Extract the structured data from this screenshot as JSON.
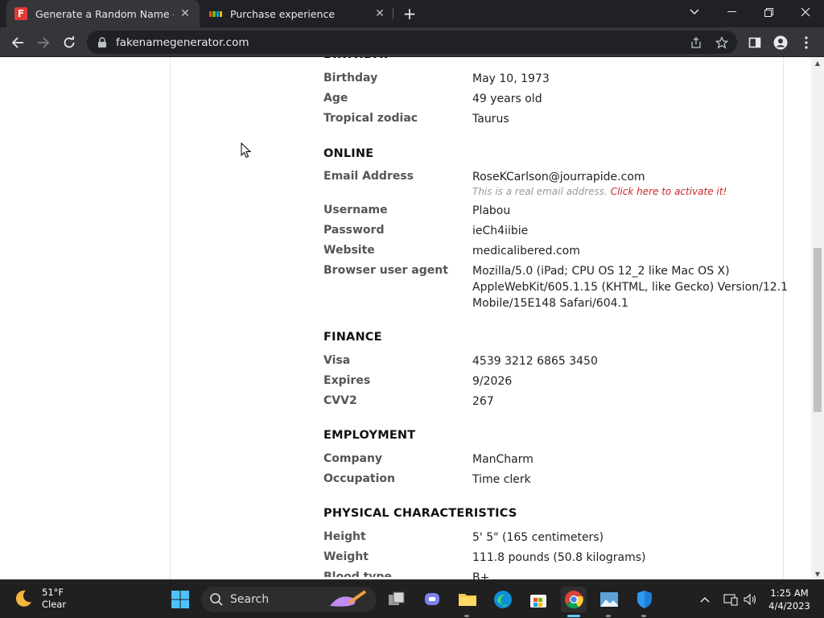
{
  "browser": {
    "tabs": [
      {
        "title": "Generate a Random Name - Fake",
        "active": true
      },
      {
        "title": "Purchase experience",
        "active": false
      }
    ],
    "url": "fakenamegenerator.com"
  },
  "page": {
    "sections": {
      "birthday": {
        "title": "BIRTHDAY",
        "rows": [
          {
            "label": "Birthday",
            "value": "May 10, 1973"
          },
          {
            "label": "Age",
            "value": "49 years old"
          },
          {
            "label": "Tropical zodiac",
            "value": "Taurus"
          }
        ]
      },
      "online": {
        "title": "ONLINE",
        "email_label": "Email Address",
        "email_value": "RoseKCarlson@jourrapide.com",
        "email_note": "This is a real email address.",
        "email_link": "Click here to activate it!",
        "rows": [
          {
            "label": "Username",
            "value": "Plabou"
          },
          {
            "label": "Password",
            "value": "ieCh4iibie"
          },
          {
            "label": "Website",
            "value": "medicalibered.com"
          }
        ],
        "ua_label": "Browser user agent",
        "ua_lines": [
          "Mozilla/5.0 (iPad; CPU OS 12_2 like Mac OS X)",
          "AppleWebKit/605.1.15 (KHTML, like Gecko) Version/12.1",
          "Mobile/15E148 Safari/604.1"
        ]
      },
      "finance": {
        "title": "FINANCE",
        "rows": [
          {
            "label": "Visa",
            "value": "4539 3212 6865 3450"
          },
          {
            "label": "Expires",
            "value": "9/2026"
          },
          {
            "label": "CVV2",
            "value": "267"
          }
        ]
      },
      "employment": {
        "title": "EMPLOYMENT",
        "rows": [
          {
            "label": "Company",
            "value": "ManCharm"
          },
          {
            "label": "Occupation",
            "value": "Time clerk"
          }
        ]
      },
      "physical": {
        "title": "PHYSICAL CHARACTERISTICS",
        "rows": [
          {
            "label": "Height",
            "value": "5' 5\" (165 centimeters)"
          },
          {
            "label": "Weight",
            "value": "111.8 pounds (50.8 kilograms)"
          },
          {
            "label": "Blood type",
            "value": "B+"
          }
        ]
      }
    }
  },
  "taskbar": {
    "weather_temp": "51°F",
    "weather_desc": "Clear",
    "search_label": "Search",
    "time": "1:25 AM",
    "date": "4/4/2023"
  },
  "colors": {
    "accent_link": "#c62828",
    "taskbar_active": "#60cdff"
  }
}
